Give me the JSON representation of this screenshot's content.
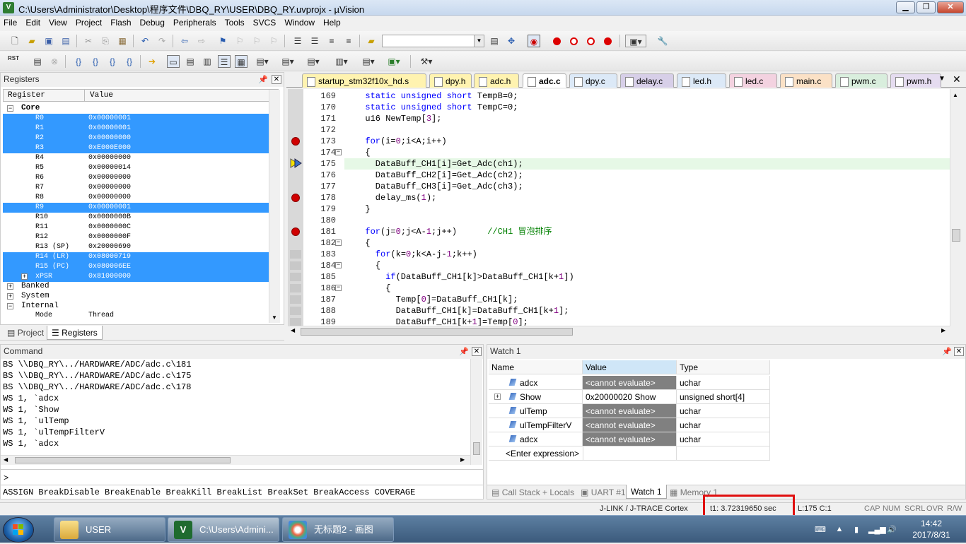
{
  "window": {
    "title": "C:\\Users\\Administrator\\Desktop\\程序文件\\DBQ_RY\\USER\\DBQ_RY.uvprojx - µVision",
    "app_icon": "V",
    "min": "▁",
    "max": "❐",
    "close": "✕"
  },
  "menu": [
    "File",
    "Edit",
    "View",
    "Project",
    "Flash",
    "Debug",
    "Peripherals",
    "Tools",
    "SVCS",
    "Window",
    "Help"
  ],
  "toolbar2": {
    "rst_label": "RST"
  },
  "registers": {
    "panel_title": "Registers",
    "col_register": "Register",
    "col_value": "Value",
    "core_label": "Core",
    "rows": [
      {
        "name": "R0",
        "value": "0x00000001",
        "selected": true
      },
      {
        "name": "R1",
        "value": "0x00000001",
        "selected": true
      },
      {
        "name": "R2",
        "value": "0x00000000",
        "selected": true
      },
      {
        "name": "R3",
        "value": "0xE000E000",
        "selected": true
      },
      {
        "name": "R4",
        "value": "0x00000000",
        "selected": false
      },
      {
        "name": "R5",
        "value": "0x00000014",
        "selected": false
      },
      {
        "name": "R6",
        "value": "0x00000000",
        "selected": false
      },
      {
        "name": "R7",
        "value": "0x00000000",
        "selected": false
      },
      {
        "name": "R8",
        "value": "0x00000000",
        "selected": false
      },
      {
        "name": "R9",
        "value": "0x00000001",
        "selected": true
      },
      {
        "name": "R10",
        "value": "0x0000000B",
        "selected": false
      },
      {
        "name": "R11",
        "value": "0x0000000C",
        "selected": false
      },
      {
        "name": "R12",
        "value": "0x0000000F",
        "selected": false
      },
      {
        "name": "R13 (SP)",
        "value": "0x20000690",
        "selected": false
      },
      {
        "name": "R14 (LR)",
        "value": "0x08000719",
        "selected": true
      },
      {
        "name": "R15 (PC)",
        "value": "0x080006EE",
        "selected": true
      },
      {
        "name": "xPSR",
        "value": "0x81000000",
        "selected": true
      }
    ],
    "groups": [
      "Banked",
      "System",
      "Internal"
    ],
    "mode_label": "Mode",
    "mode_value": "Thread",
    "tab_project": "Project",
    "tab_registers": "Registers"
  },
  "editor": {
    "tabs": [
      {
        "label": "startup_stm32f10x_hd.s",
        "color": "#fff3b0",
        "active": false
      },
      {
        "label": "dpy.h",
        "color": "#fff3b0",
        "active": false
      },
      {
        "label": "adc.h",
        "color": "#fff3b0",
        "active": false
      },
      {
        "label": "adc.c",
        "color": "#ffffff",
        "active": true
      },
      {
        "label": "dpy.c",
        "color": "#dce9f7",
        "active": false
      },
      {
        "label": "delay.c",
        "color": "#d7cfe8",
        "active": false
      },
      {
        "label": "led.h",
        "color": "#dce9f7",
        "active": false
      },
      {
        "label": "led.c",
        "color": "#f3d2e0",
        "active": false
      },
      {
        "label": "main.c",
        "color": "#fbe1c6",
        "active": false
      },
      {
        "label": "pwm.c",
        "color": "#d9eedd",
        "active": false
      },
      {
        "label": "pwm.h",
        "color": "#e5dcf0",
        "active": false
      }
    ],
    "lines": [
      {
        "n": "169",
        "code": [
          [
            "kw",
            "  static unsigned short "
          ],
          [
            "",
            "TempB=0;"
          ]
        ],
        "bp": false,
        "fold": ""
      },
      {
        "n": "170",
        "code": [
          [
            "kw",
            "  static unsigned short "
          ],
          [
            "",
            "TempC=0;"
          ]
        ],
        "bp": false,
        "fold": ""
      },
      {
        "n": "171",
        "code": [
          [
            "",
            "  u16 NewTemp["
          ],
          [
            "nb",
            "3"
          ],
          [
            "",
            "];"
          ]
        ],
        "bp": false,
        "fold": ""
      },
      {
        "n": "172",
        "code": [
          [
            "",
            ""
          ]
        ],
        "bp": false,
        "fold": ""
      },
      {
        "n": "173",
        "code": [
          [
            "kw",
            "  for"
          ],
          [
            "",
            "(i="
          ],
          [
            "nb",
            "0"
          ],
          [
            "",
            ";i<A;i++)"
          ]
        ],
        "bp": true,
        "fold": ""
      },
      {
        "n": "174",
        "code": [
          [
            "",
            "  {"
          ]
        ],
        "bp": false,
        "fold": "−"
      },
      {
        "n": "175",
        "code": [
          [
            "",
            "    DataBuff_CH1[i]=Get_Adc(ch1);"
          ]
        ],
        "bp": false,
        "fold": "",
        "current": true
      },
      {
        "n": "176",
        "code": [
          [
            "",
            "    DataBuff_CH2[i]=Get_Adc(ch2);"
          ]
        ],
        "bp": false,
        "fold": ""
      },
      {
        "n": "177",
        "code": [
          [
            "",
            "    DataBuff_CH3[i]=Get_Adc(ch3);"
          ]
        ],
        "bp": false,
        "fold": ""
      },
      {
        "n": "178",
        "code": [
          [
            "",
            "    delay_ms("
          ],
          [
            "nb",
            "1"
          ],
          [
            "",
            ");"
          ]
        ],
        "bp": true,
        "fold": ""
      },
      {
        "n": "179",
        "code": [
          [
            "",
            "  }"
          ]
        ],
        "bp": false,
        "fold": ""
      },
      {
        "n": "180",
        "code": [
          [
            "",
            ""
          ]
        ],
        "bp": false,
        "fold": ""
      },
      {
        "n": "181",
        "code": [
          [
            "kw",
            "  for"
          ],
          [
            "",
            "(j="
          ],
          [
            "nb",
            "0"
          ],
          [
            "",
            ";j<A-"
          ],
          [
            "nb",
            "1"
          ],
          [
            "",
            ";j++)      "
          ],
          [
            "cm",
            "//CH1 冒泡排序"
          ]
        ],
        "bp": true,
        "fold": ""
      },
      {
        "n": "182",
        "code": [
          [
            "",
            "  {"
          ]
        ],
        "bp": false,
        "fold": "−"
      },
      {
        "n": "183",
        "code": [
          [
            "kw",
            "    for"
          ],
          [
            "",
            "(k="
          ],
          [
            "nb",
            "0"
          ],
          [
            "",
            ";k<A-j-"
          ],
          [
            "nb",
            "1"
          ],
          [
            "",
            ";k++)"
          ]
        ],
        "bp": false,
        "fold": ""
      },
      {
        "n": "184",
        "code": [
          [
            "",
            "    {"
          ]
        ],
        "bp": false,
        "fold": "−"
      },
      {
        "n": "185",
        "code": [
          [
            "kw",
            "      if"
          ],
          [
            "",
            "(DataBuff_CH1[k]>DataBuff_CH1[k+"
          ],
          [
            "nb",
            "1"
          ],
          [
            "",
            "])"
          ]
        ],
        "bp": false,
        "fold": ""
      },
      {
        "n": "186",
        "code": [
          [
            "",
            "      {"
          ]
        ],
        "bp": false,
        "fold": "−"
      },
      {
        "n": "187",
        "code": [
          [
            "",
            "        Temp["
          ],
          [
            "nb",
            "0"
          ],
          [
            "",
            "]=DataBuff_CH1[k];"
          ]
        ],
        "bp": false,
        "fold": ""
      },
      {
        "n": "188",
        "code": [
          [
            "",
            "        DataBuff_CH1[k]=DataBuff_CH1[k+"
          ],
          [
            "nb",
            "1"
          ],
          [
            "",
            "];"
          ]
        ],
        "bp": false,
        "fold": ""
      },
      {
        "n": "189",
        "code": [
          [
            "",
            "        DataBuff_CH1[k+"
          ],
          [
            "nb",
            "1"
          ],
          [
            "",
            "]=Temp["
          ],
          [
            "nb",
            "0"
          ],
          [
            "",
            "];"
          ]
        ],
        "bp": false,
        "fold": ""
      }
    ]
  },
  "command": {
    "panel_title": "Command",
    "lines": [
      "BS \\\\DBQ_RY\\../HARDWARE/ADC/adc.c\\181",
      "BS \\\\DBQ_RY\\../HARDWARE/ADC/adc.c\\175",
      "BS \\\\DBQ_RY\\../HARDWARE/ADC/adc.c\\178",
      "WS 1, `adcx",
      "WS 1, `Show",
      "WS 1, `ulTemp",
      "WS 1, `ulTempFilterV",
      "WS 1, `adcx"
    ],
    "prompt": ">",
    "hint": "ASSIGN BreakDisable BreakEnable BreakKill BreakList BreakSet BreakAccess COVERAGE"
  },
  "watch": {
    "panel_title": "Watch 1",
    "col_name": "Name",
    "col_value": "Value",
    "col_type": "Type",
    "rows": [
      {
        "name": "adcx",
        "value": "<cannot evaluate>",
        "type": "uchar",
        "gray": true,
        "expand": false
      },
      {
        "name": "Show",
        "value": "0x20000020 Show",
        "type": "unsigned short[4]",
        "gray": false,
        "expand": true
      },
      {
        "name": "ulTemp",
        "value": "<cannot evaluate>",
        "type": "uchar",
        "gray": true,
        "expand": false
      },
      {
        "name": "ulTempFilterV",
        "value": "<cannot evaluate>",
        "type": "uchar",
        "gray": true,
        "expand": false
      },
      {
        "name": "adcx",
        "value": "<cannot evaluate>",
        "type": "uchar",
        "gray": true,
        "expand": false
      }
    ],
    "enter_expression": "<Enter expression>",
    "tabs": [
      "Call Stack + Locals",
      "UART #1",
      "Watch 1",
      "Memory 1"
    ]
  },
  "status": {
    "debugger": "J-LINK / J-TRACE Cortex",
    "time": "t1: 3.72319650 sec",
    "cursor": "L:175 C:1",
    "cap": "CAP",
    "num": "NUM",
    "scrl": "SCRL",
    "ovr": "OVR",
    "rw": "R/W"
  },
  "taskbar": {
    "items": [
      {
        "label": "USER",
        "icon": "folder-icon"
      },
      {
        "label": "C:\\Users\\Admini...",
        "icon": "uvision-icon"
      },
      {
        "label": "无标题2 - 画图",
        "icon": "paint-icon"
      }
    ],
    "time": "14:42",
    "date": "2017/8/31"
  }
}
